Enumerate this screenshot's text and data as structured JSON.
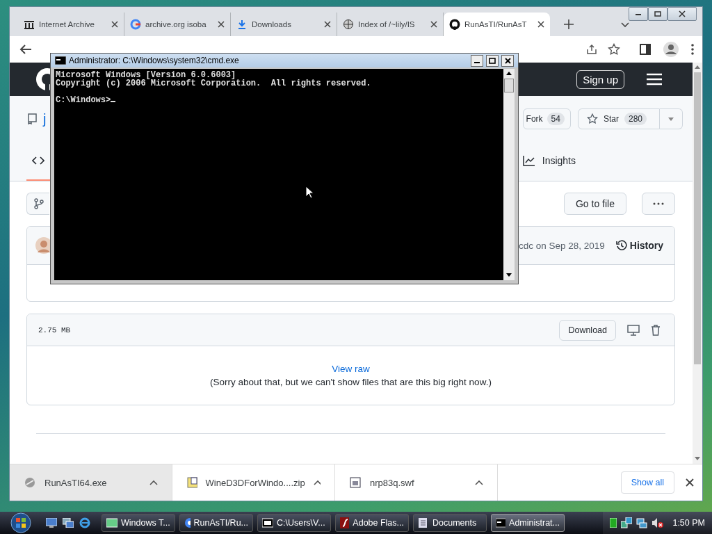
{
  "browser": {
    "tabs": [
      {
        "kind": "archive",
        "title": "Internet Archive",
        "selected": false
      },
      {
        "kind": "google",
        "title": "archive.org isoba",
        "selected": false
      },
      {
        "kind": "download",
        "title": "Downloads",
        "selected": false
      },
      {
        "kind": "index",
        "title": "Index of /~lily/IS",
        "selected": false
      },
      {
        "kind": "github",
        "title": "RunAsTI/RunAsT",
        "selected": true
      }
    ]
  },
  "page": {
    "header": {
      "sign_up": "Sign up"
    },
    "repo": {
      "name": "j",
      "fork": {
        "label": "Fork",
        "count": "54"
      },
      "star": {
        "label": "Star",
        "count": "280"
      }
    },
    "nav": [
      {
        "kind": "code",
        "selected": true
      },
      {
        "kind": "insights",
        "label": "Insights",
        "selected": false
      }
    ],
    "go_to_file": "Go to file",
    "commit": {
      "text": "cdc on Sep 28, 2019",
      "history": "History"
    },
    "file": {
      "size": "2.75 MB",
      "download": "Download",
      "view_raw": "View raw",
      "message": "(Sorry about that, but we can't show files that are this big right now.)"
    }
  },
  "downloads": {
    "items": [
      {
        "kind": "exe",
        "name": "RunAsTI64.exe",
        "selected": true
      },
      {
        "kind": "zip",
        "name": "WineD3DForWindo....zip",
        "selected": false
      },
      {
        "kind": "swf",
        "name": "nrp83q.swf",
        "selected": false
      }
    ],
    "show_all": "Show all"
  },
  "console": {
    "title": "Administrator: C:\\Windows\\system32\\cmd.exe",
    "banner": [
      "Microsoft Windows [Version 6.0.6003]",
      "Copyright (c) 2006 Microsoft Corporation.  All rights reserved."
    ],
    "prompt": "C:\\Windows>"
  },
  "taskbar": {
    "items": [
      {
        "kind": "window",
        "label": "Windows T...",
        "selected": false
      },
      {
        "kind": "chrome",
        "label": "RunAsTI/Ru...",
        "selected": false
      },
      {
        "kind": "zip",
        "label": "C:\\Users\\V...",
        "selected": false
      },
      {
        "kind": "flash",
        "label": "Adobe Flas...",
        "selected": false
      },
      {
        "kind": "folder",
        "label": "Documents",
        "selected": false
      },
      {
        "kind": "console",
        "label": "Administrat...",
        "selected": true
      }
    ],
    "clock": "1:50 PM"
  }
}
